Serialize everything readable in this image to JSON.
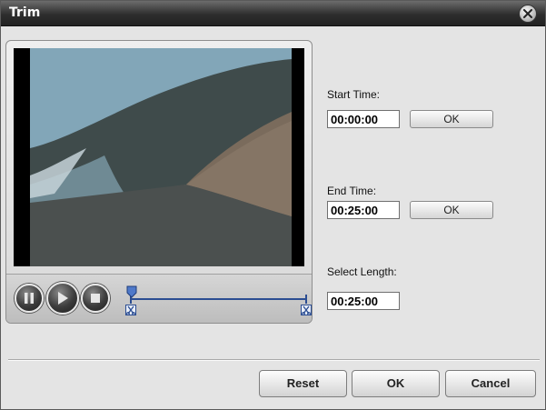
{
  "window": {
    "title": "Trim"
  },
  "preview": {
    "scene_colors": {
      "sky": "#7aa0b2",
      "wave": "#3e4a4a",
      "water": "#4d5150",
      "sand": "#7b6d5e",
      "foam": "#c8d4da"
    }
  },
  "player": {
    "icons": [
      "pause-icon",
      "play-icon",
      "stop-icon"
    ],
    "position_fraction": 0.0,
    "range_start_fraction": 0.0,
    "range_end_fraction": 1.0
  },
  "trim": {
    "start": {
      "label": "Start Time:",
      "value": "00:00:00",
      "ok_label": "OK"
    },
    "end": {
      "label": "End Time:",
      "value": "00:25:00",
      "ok_label": "OK"
    },
    "length": {
      "label": "Select Length:",
      "value": "00:25:00"
    }
  },
  "footer": {
    "reset_label": "Reset",
    "ok_label": "OK",
    "cancel_label": "Cancel"
  },
  "colors": {
    "accent": "#2b4d92",
    "titlebar": "#2e2e2e",
    "dialog_bg": "#e4e4e4"
  }
}
